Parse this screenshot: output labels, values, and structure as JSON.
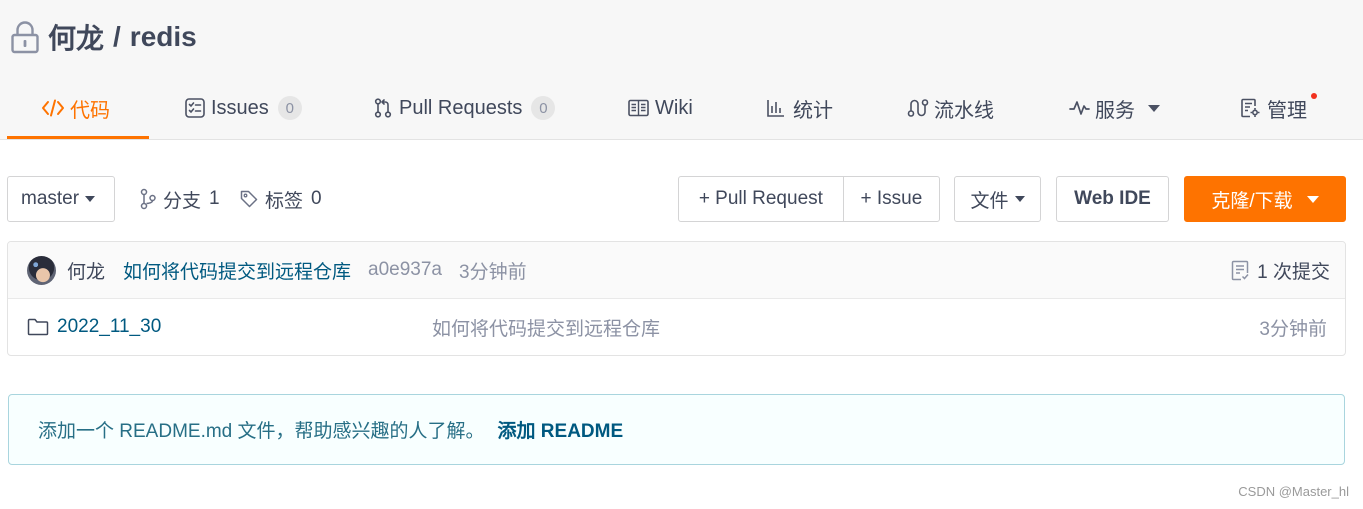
{
  "repo": {
    "owner": "何龙",
    "separator": "/",
    "name": "redis",
    "visibility_icon": "lock-icon"
  },
  "tabs": [
    {
      "label": "代码",
      "icon": "code-icon",
      "active": true
    },
    {
      "label": "Issues",
      "icon": "issues-icon",
      "badge": "0"
    },
    {
      "label": "Pull Requests",
      "icon": "pull-request-icon",
      "badge": "0"
    },
    {
      "label": "Wiki",
      "icon": "book-icon"
    },
    {
      "label": "统计",
      "icon": "bar-chart-icon"
    },
    {
      "label": "流水线",
      "icon": "pipeline-icon"
    },
    {
      "label": "服务",
      "icon": "pulse-icon",
      "dropdown_icon": "caret-down-icon"
    },
    {
      "label": "管理",
      "icon": "settings-doc-icon",
      "notification_dot": true
    }
  ],
  "toolbar": {
    "branch_select": "master",
    "branches_label": "分支",
    "branches_count": "1",
    "tags_label": "标签",
    "tags_count": "0",
    "new_pull_request": "+ Pull Request",
    "new_issue": "+ Issue",
    "file_menu": "文件",
    "web_ide": "Web IDE",
    "clone_download": "克隆/下载"
  },
  "latest_commit": {
    "author": "何龙",
    "message": "如何将代码提交到远程仓库",
    "sha": "a0e937a",
    "time": "3分钟前",
    "commit_count": "1 次提交"
  },
  "files": [
    {
      "type": "folder",
      "icon": "folder-icon",
      "name": "2022_11_30",
      "message": "如何将代码提交到远程仓库",
      "time": "3分钟前"
    }
  ],
  "readme_notice": {
    "text": "添加一个 README.md 文件，帮助感兴趣的人了解。",
    "link": "添加 README"
  },
  "watermark": "CSDN @Master_hl",
  "colors": {
    "accent": "#fe7300",
    "link": "#005980",
    "text": "#40485b",
    "muted": "#8c92a4",
    "notification_dot": "#f2311f",
    "info_bg": "#f8ffff",
    "info_border": "#a9d5de",
    "info_text": "#276f86"
  }
}
